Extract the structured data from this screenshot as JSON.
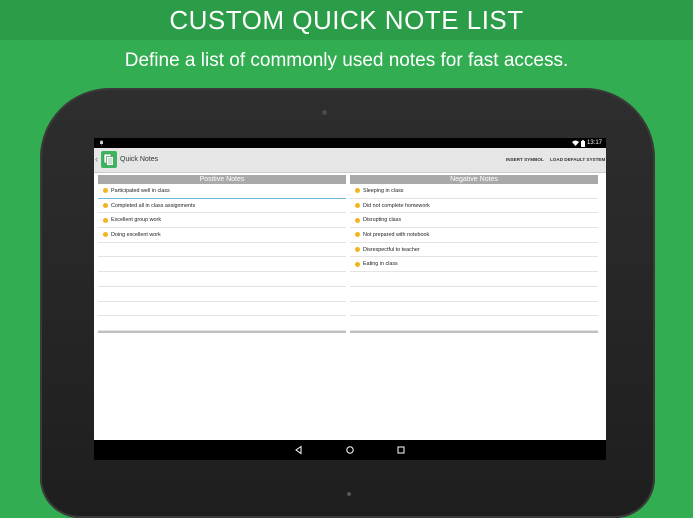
{
  "promo": {
    "headline": "CUSTOM QUICK NOTE LIST",
    "subtitle": "Define a list of commonly used notes for fast access."
  },
  "status_bar": {
    "time": "13:17"
  },
  "app_bar": {
    "title": "Quick Notes",
    "actions": {
      "insert_symbol": "INSERT SYMBOL",
      "load_default": "LOAD DEFAULT SYSTEM"
    }
  },
  "positive": {
    "header": "Positive Notes",
    "items": [
      "Participated well in class",
      "Completed all in class assignments",
      "Excellent group work",
      "Doing excellent work"
    ],
    "selected_index": 0
  },
  "negative": {
    "header": "Negative Notes",
    "items": [
      "Sleeping in class",
      "Did not complete homework",
      "Disrupting class",
      "Not prepared with notebook",
      "Disrespectful to teacher",
      "Eating in class"
    ]
  },
  "colors": {
    "background": "#33ad52",
    "headline_band": "#2b9c47",
    "column_header": "#a9a9a9",
    "smiley": "#f2b51f",
    "selected_underline": "#6fb7d9"
  },
  "icons": {
    "app": "notes-app-icon",
    "back": "chevron-left-icon",
    "smiley": "smiley-face-icon",
    "nav_back": "nav-back-icon",
    "nav_home": "nav-home-icon",
    "nav_recent": "nav-recent-icon",
    "wifi": "wifi-icon",
    "battery": "battery-icon",
    "notification": "notification-icon"
  }
}
